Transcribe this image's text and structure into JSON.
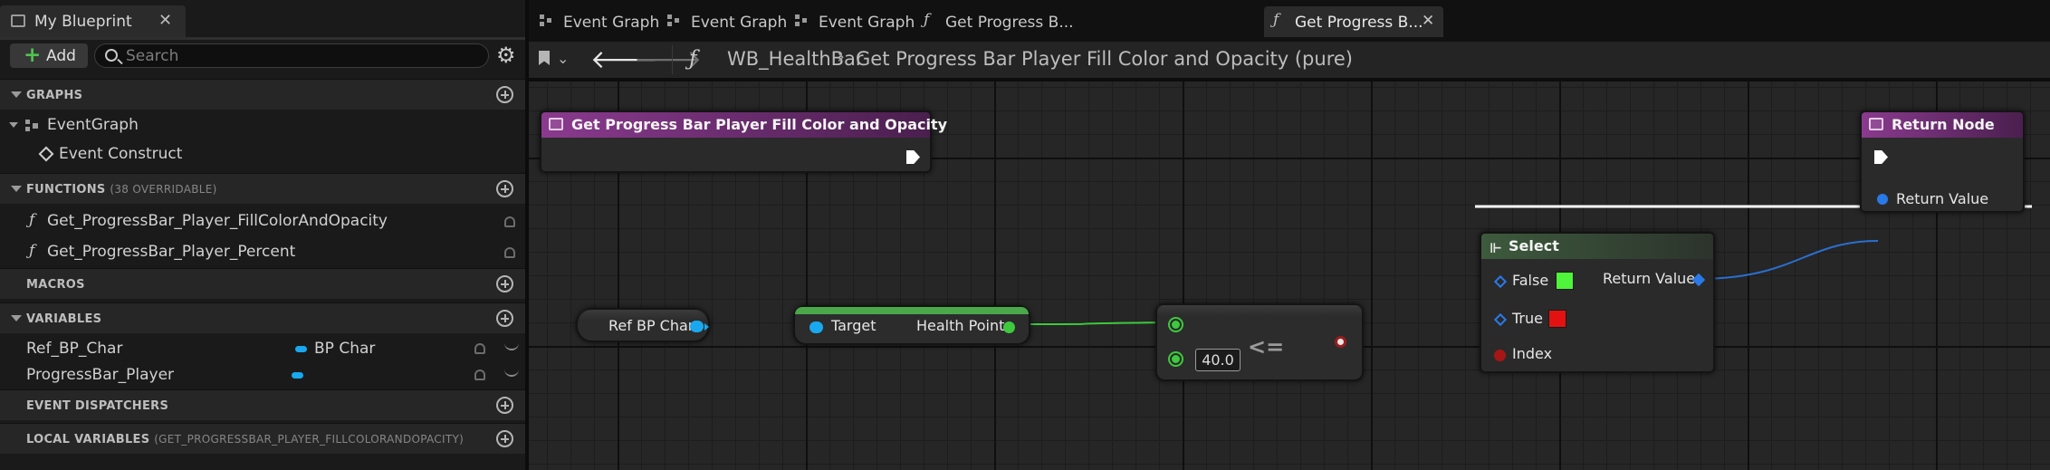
{
  "panel": {
    "tab_title": "My Blueprint",
    "tab_close": "✕",
    "add_label": "Add",
    "search_placeholder": "Search",
    "sections": {
      "graphs": "GRAPHS",
      "functions": "FUNCTIONS",
      "functions_sub": "(38 OVERRIDABLE)",
      "macros": "MACROS",
      "variables": "VARIABLES",
      "event_dispatchers": "EVENT DISPATCHERS",
      "local_variables": "LOCAL VARIABLES",
      "local_variables_sub": "(GET_PROGRESSBAR_PLAYER_FILLCOLORANDOPACITY)"
    },
    "graphs": {
      "event_graph": "EventGraph",
      "event_construct": "Event Construct"
    },
    "functions": [
      "Get_ProgressBar_Player_FillColorAndOpacity",
      "Get_ProgressBar_Player_Percent"
    ],
    "variables": [
      {
        "name": "Ref_BP_Char",
        "type": "BP Char",
        "type_color": "#19a8ef"
      },
      {
        "name": "ProgressBar_Player",
        "type": "",
        "type_color": "#19a8ef"
      }
    ]
  },
  "tabs": [
    {
      "label": "Event Graph",
      "icon": "graph-icon",
      "active": false
    },
    {
      "label": "Event Graph",
      "icon": "graph-icon",
      "active": false
    },
    {
      "label": "Event Graph",
      "icon": "graph-icon",
      "active": false
    },
    {
      "label": "Get Progress B...",
      "icon": "function-icon",
      "active": false
    },
    {
      "label": "Get Progress B...",
      "icon": "function-icon",
      "active": true,
      "close": "✕"
    }
  ],
  "toolbar": {
    "fx": "ƒ",
    "crumb_blueprint": "WB_HealthBar",
    "crumb_function": "Get Progress Bar Player Fill Color and Opacity (pure)"
  },
  "nodes": {
    "entry": {
      "title": "Get Progress Bar Player Fill Color and Opacity",
      "header_color": "#7a2a7e"
    },
    "return": {
      "title": "Return Node",
      "header_color": "#7a2a7e",
      "pin": "Return Value"
    },
    "ref_bp_char": {
      "label": "Ref BP Char"
    },
    "get_health": {
      "target": "Target",
      "output": "Health Point",
      "header_color": "#3f8f3f"
    },
    "compare": {
      "operator": "<=",
      "literal": "40.0"
    },
    "select": {
      "title": "Select",
      "false_label": "False",
      "true_label": "True",
      "index_label": "Index",
      "return_label": "Return Value",
      "false_color": "#4ef53a",
      "true_color": "#e31212",
      "header_color": "#3a4a3a"
    }
  },
  "colors": {
    "exec_wire": "#ffffff",
    "object_wire": "#1aa3e8",
    "float_wire": "#3ec93e",
    "bool_wire": "#8c1a1a",
    "wildcard_wire": "#2a6fd0"
  }
}
